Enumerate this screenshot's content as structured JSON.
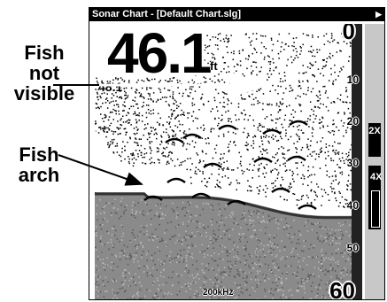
{
  "window": {
    "title": "Sonar Chart - [Default Chart.slg]"
  },
  "callouts": {
    "fish_not_visible": [
      "Fish",
      "not",
      "visible"
    ],
    "fish_arch": [
      "Fish",
      "arch"
    ]
  },
  "readouts": {
    "depth": "46.1",
    "depth_unit": "ft",
    "cursor_depth": "48.1",
    "frequency": "200kHz"
  },
  "depth_scale": {
    "top": "0",
    "bottom": "60",
    "ticks": [
      "10",
      "20",
      "30",
      "40",
      "50"
    ]
  },
  "zoom": {
    "level_1": "2X",
    "level_2": "4X"
  }
}
